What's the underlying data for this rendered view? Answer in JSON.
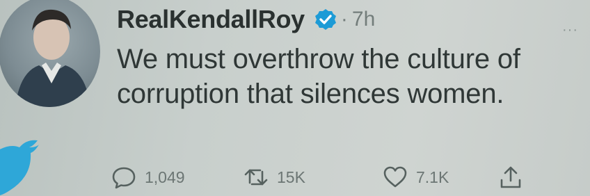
{
  "tweet": {
    "display_name": "RealKendallRoy",
    "separator": "·",
    "time": "7h",
    "more_label": "···",
    "text": "We must overthrow the culture of corruption that silences women.",
    "actions": {
      "reply": {
        "icon": "reply-icon",
        "count": "1,049"
      },
      "retweet": {
        "icon": "retweet-icon",
        "count": "15K"
      },
      "like": {
        "icon": "heart-icon",
        "count": "7.1K"
      },
      "share": {
        "icon": "share-icon"
      }
    }
  },
  "colors": {
    "verified_badge": "#1d9bd6",
    "background": "#c8cfcc",
    "bird": "#2ea7d8"
  }
}
